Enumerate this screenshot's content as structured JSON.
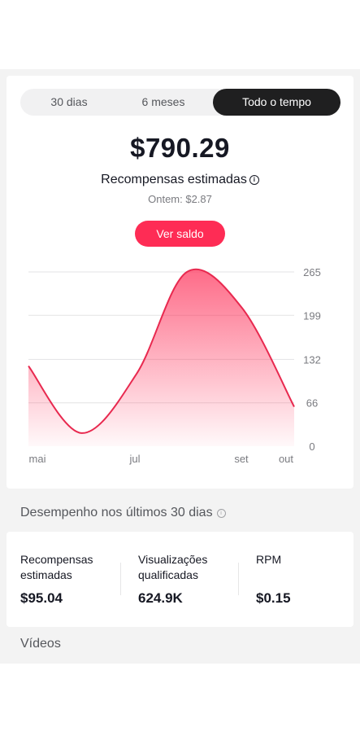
{
  "tabs": [
    {
      "label": "30 dias",
      "active": false
    },
    {
      "label": "6 meses",
      "active": false
    },
    {
      "label": "Todo o tempo",
      "active": true
    }
  ],
  "balance": "$790.29",
  "reward_title": "Recompensas estimadas",
  "yesterday": "Ontem: $2.87",
  "ver_saldo_label": "Ver saldo",
  "colors": {
    "accent": "#fe2c55",
    "active_tab": "#1f1f20"
  },
  "chart_data": {
    "type": "area",
    "x_labels": [
      "mai",
      "jul",
      "set",
      "out"
    ],
    "y_ticks": [
      265,
      199,
      132,
      66,
      0
    ],
    "ylim": [
      0,
      265
    ],
    "series": [
      {
        "values": [
          122,
          20,
          110,
          265,
          210,
          60
        ]
      }
    ],
    "grid": true
  },
  "performance_title": "Desempenho nos últimos 30 dias",
  "stats": [
    {
      "label": "Recompensas estimadas",
      "value": "$95.04"
    },
    {
      "label": "Visualizações qualificadas",
      "value": "624.9K"
    },
    {
      "label": "RPM",
      "value": "$0.15"
    }
  ],
  "videos_title": "Vídeos"
}
